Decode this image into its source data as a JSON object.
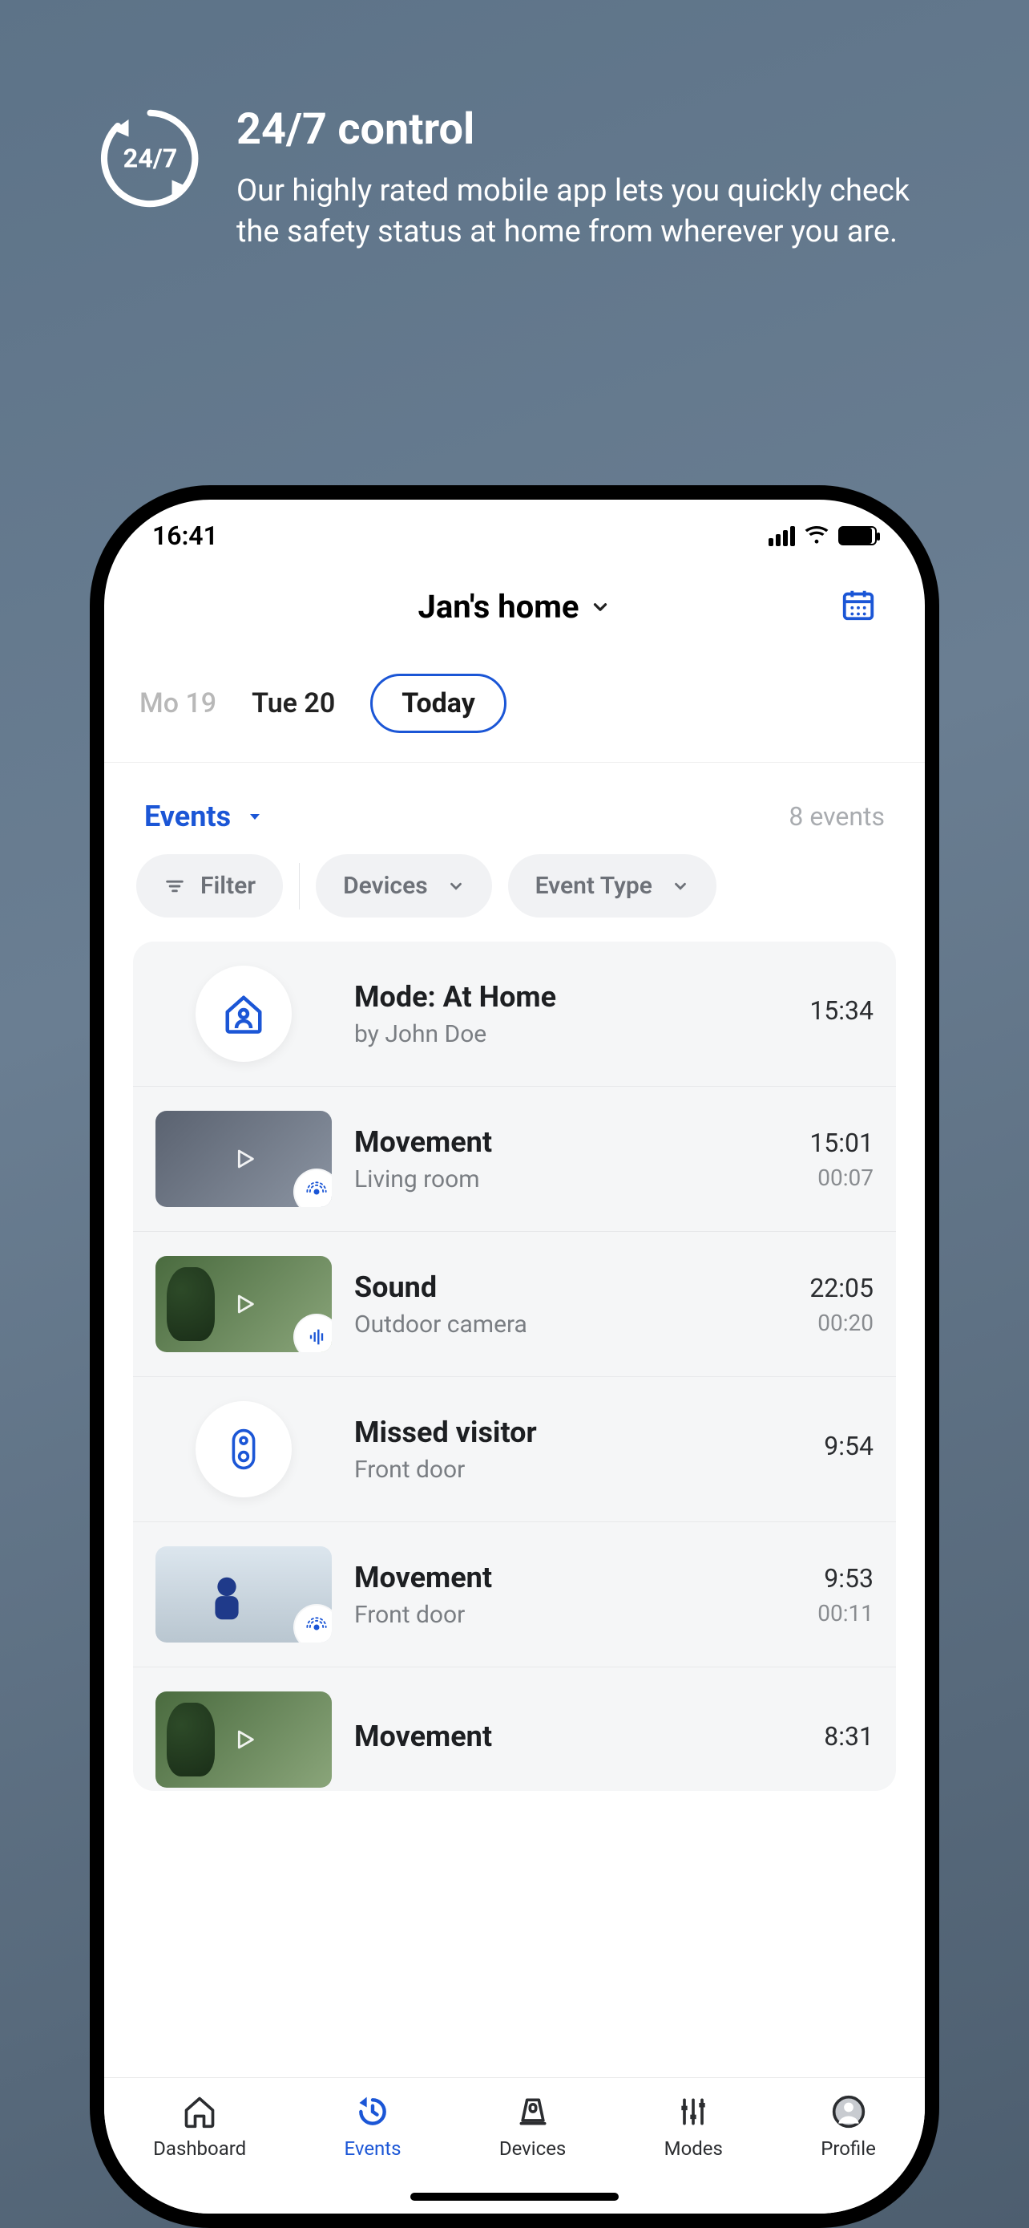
{
  "promo": {
    "title": "24/7 control",
    "body": "Our highly rated mobile app lets you quickly check the safety status at home from wherever you are.",
    "badge_text": "24/7"
  },
  "status": {
    "time": "16:41"
  },
  "header": {
    "home_name": "Jan's home"
  },
  "dates": {
    "prev2": "Mo 19",
    "prev1": "Tue 20",
    "today": "Today"
  },
  "events_header": {
    "label": "Events",
    "count": "8 events"
  },
  "chips": {
    "filter": "Filter",
    "devices": "Devices",
    "event_type": "Event Type"
  },
  "events": [
    {
      "kind": "mode",
      "title": "Mode: At Home",
      "sub": "by John Doe",
      "t1": "15:34",
      "t2": ""
    },
    {
      "kind": "movement",
      "title": "Movement",
      "sub": "Living room",
      "t1": "15:01",
      "t2": "00:07",
      "thumb": "room",
      "badge": "motion"
    },
    {
      "kind": "sound",
      "title": "Sound",
      "sub": "Outdoor camera",
      "t1": "22:05",
      "t2": "00:20",
      "thumb": "outdoor",
      "badge": "sound"
    },
    {
      "kind": "missed",
      "title": "Missed visitor",
      "sub": "Front door",
      "t1": "9:54",
      "t2": ""
    },
    {
      "kind": "movement",
      "title": "Movement",
      "sub": "Front door",
      "t1": "9:53",
      "t2": "00:11",
      "thumb": "door",
      "badge": "motion"
    },
    {
      "kind": "movement",
      "title": "Movement",
      "sub": "",
      "t1": "8:31",
      "t2": "",
      "thumb": "outdoor",
      "badge": "motion"
    }
  ],
  "tabs": {
    "dashboard": "Dashboard",
    "events": "Events",
    "devices": "Devices",
    "modes": "Modes",
    "profile": "Profile"
  },
  "colors": {
    "accent": "#1b56d6"
  }
}
